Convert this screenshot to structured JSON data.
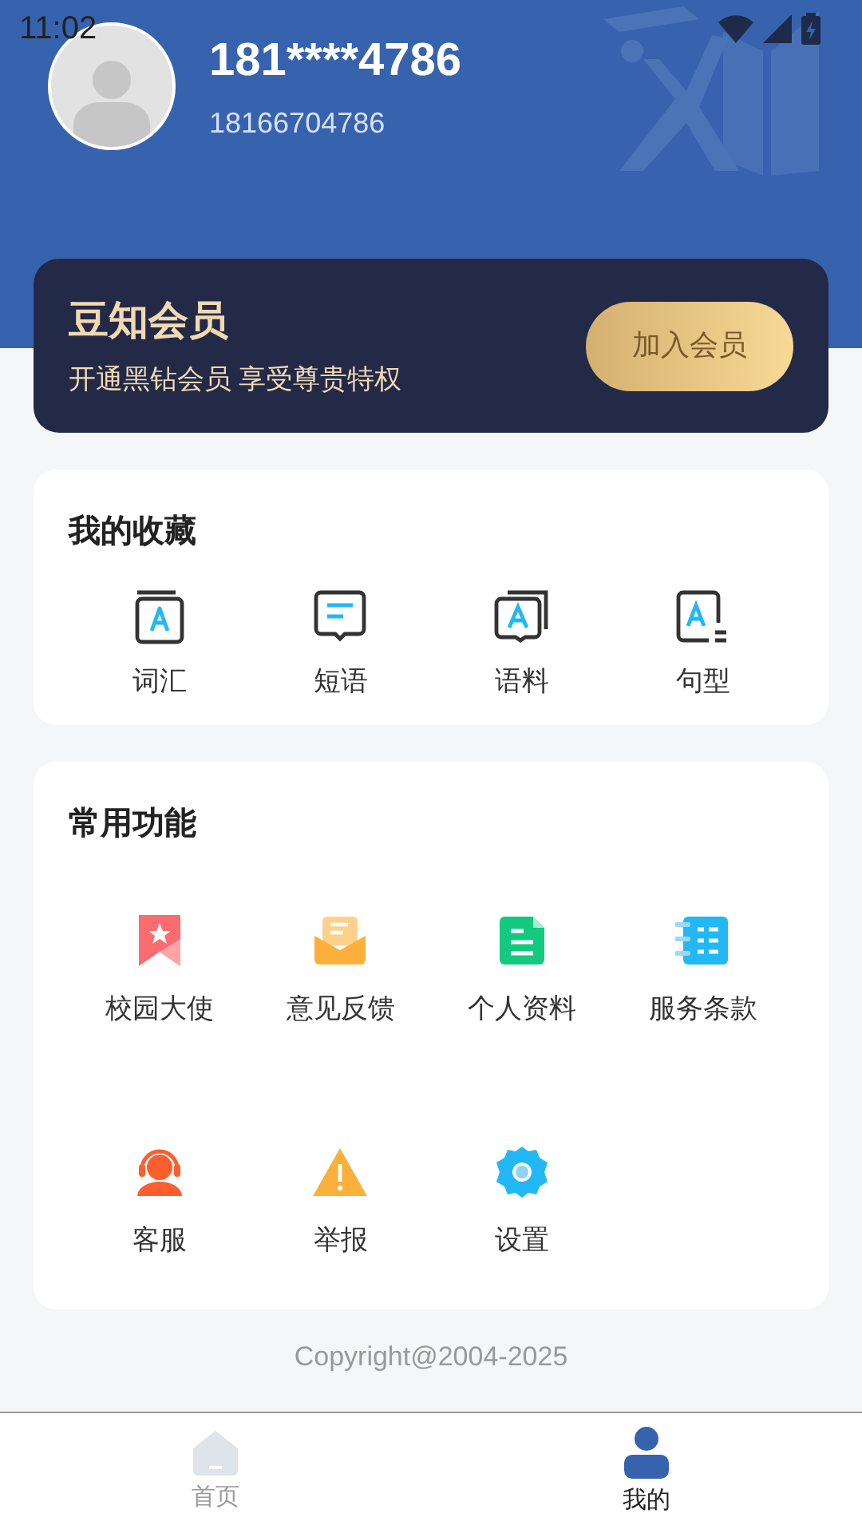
{
  "status_bar": {
    "time": "11:02"
  },
  "profile": {
    "name": "181****4786",
    "phone": "18166704786"
  },
  "membership": {
    "title": "豆知会员",
    "subtitle": "开通黑钻会员 享受尊贵特权",
    "button": "加入会员"
  },
  "favorites": {
    "title": "我的收藏",
    "items": [
      {
        "label": "词汇",
        "kind": "book"
      },
      {
        "label": "短语",
        "kind": "chat"
      },
      {
        "label": "语料",
        "kind": "stack"
      },
      {
        "label": "句型",
        "kind": "doc"
      }
    ]
  },
  "functions": {
    "title": "常用功能",
    "items": [
      {
        "label": "校园大使",
        "kind": "ribbon"
      },
      {
        "label": "意见反馈",
        "kind": "mail"
      },
      {
        "label": "个人资料",
        "kind": "file"
      },
      {
        "label": "服务条款",
        "kind": "notebook"
      },
      {
        "label": "客服",
        "kind": "agent"
      },
      {
        "label": "举报",
        "kind": "warning"
      },
      {
        "label": "设置",
        "kind": "gear"
      }
    ]
  },
  "copyright": "Copyright@2004-2025",
  "nav": [
    {
      "label": "首页",
      "kind": "home",
      "selected": false
    },
    {
      "label": "我的",
      "kind": "user",
      "selected": true
    }
  ]
}
